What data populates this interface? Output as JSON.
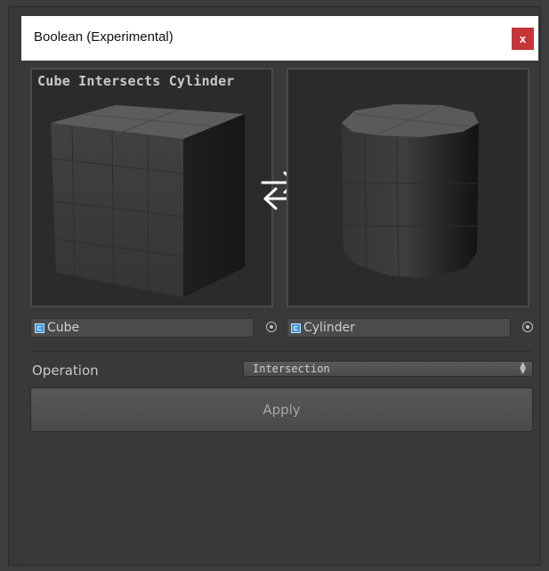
{
  "window": {
    "title": "Boolean (Experimental)",
    "close_label": "x"
  },
  "previews": {
    "left_caption": "Cube Intersects Cylinder",
    "left_object": "Cube",
    "right_object": "Cylinder"
  },
  "swap_icon": "swap-arrows-icon",
  "operation": {
    "label": "Operation",
    "selected": "Intersection"
  },
  "apply_label": "Apply",
  "colors": {
    "close_button": "#c6343a",
    "panel_background": "#393939",
    "preview_background": "#2b2b2b"
  }
}
